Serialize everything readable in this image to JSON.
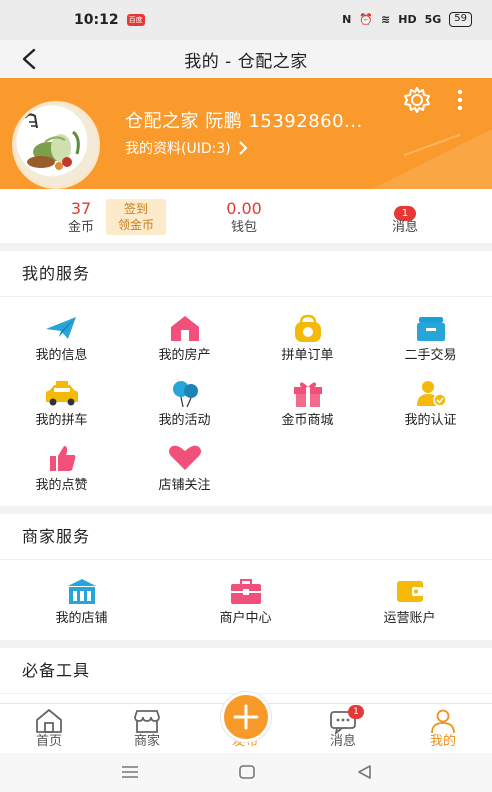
{
  "status_bar": {
    "time": "10:12",
    "app_badge": "百度",
    "battery": "59",
    "network": "5G"
  },
  "nav": {
    "title": "我的 - 仓配之家"
  },
  "profile": {
    "name": "仓配之家 阮鹏 15392860...",
    "link": "我的资料(UID:3)"
  },
  "stats": {
    "gold_value": "37",
    "gold_label": "金币",
    "signin_line1": "签到",
    "signin_line2": "领金币",
    "wallet_value": "0.00",
    "wallet_label": "钱包",
    "msg_badge": "1",
    "msg_label": "消息"
  },
  "my_services": {
    "title": "我的服务",
    "items": [
      {
        "label": "我的信息",
        "icon": "paper-plane-icon"
      },
      {
        "label": "我的房产",
        "icon": "house-icon"
      },
      {
        "label": "拼单订单",
        "icon": "group-order-icon"
      },
      {
        "label": "二手交易",
        "icon": "secondhand-icon"
      },
      {
        "label": "我的拼车",
        "icon": "car-icon"
      },
      {
        "label": "我的活动",
        "icon": "balloon-icon"
      },
      {
        "label": "金币商城",
        "icon": "gift-icon"
      },
      {
        "label": "我的认证",
        "icon": "verified-user-icon"
      },
      {
        "label": "我的点赞",
        "icon": "thumbs-up-icon"
      },
      {
        "label": "店铺关注",
        "icon": "heart-icon"
      }
    ]
  },
  "merchant_services": {
    "title": "商家服务",
    "items": [
      {
        "label": "我的店铺",
        "icon": "store-icon"
      },
      {
        "label": "商户中心",
        "icon": "briefcase-icon"
      },
      {
        "label": "运营账户",
        "icon": "wallet-icon"
      }
    ]
  },
  "tools": {
    "title": "必备工具"
  },
  "tabbar": {
    "home": "首页",
    "merchant": "商家",
    "publish": "发布",
    "messages": "消息",
    "mine": "我的",
    "messages_badge": "1"
  },
  "colors": {
    "accent": "#fb9a2c",
    "active_tab": "#f0901e",
    "badge_red": "#e53935"
  }
}
